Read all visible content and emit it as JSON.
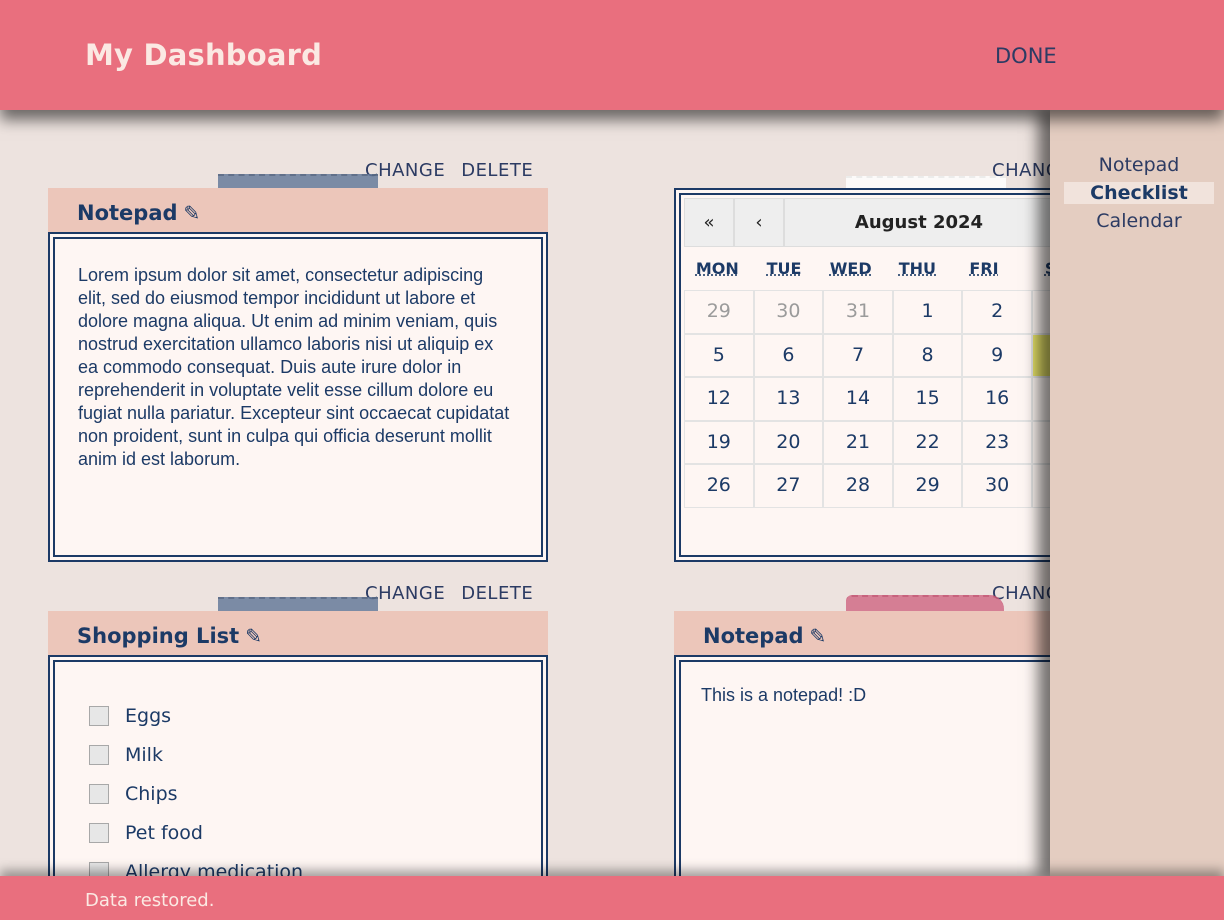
{
  "header": {
    "title": "My Dashboard",
    "done_label": "DONE"
  },
  "footer": {
    "status": "Data restored."
  },
  "actions": {
    "change": "CHANGE",
    "delete": "DELETE",
    "change_truncated": "CHANG"
  },
  "widgets": {
    "notepad1": {
      "title": "Notepad",
      "text": "Lorem ipsum dolor sit amet, consectetur adipiscing elit, sed do eiusmod tempor incididunt ut labore et dolore magna aliqua. Ut enim ad minim veniam, quis nostrud exercitation ullamco laboris nisi ut aliquip ex ea commodo consequat. Duis aute irure dolor in reprehenderit in voluptate velit esse cillum dolore eu fugiat nulla pariatur. Excepteur sint occaecat cupidatat non proident, sunt in culpa qui officia deserunt mollit anim id est laborum."
    },
    "calendar": {
      "first_label": "«",
      "prev_label": "‹",
      "month": "August 2024",
      "weekdays": [
        "MON",
        "TUE",
        "WED",
        "THU",
        "FRI",
        "S"
      ],
      "weeks": [
        [
          "29",
          "30",
          "31",
          "1",
          "2",
          ""
        ],
        [
          "5",
          "6",
          "7",
          "8",
          "9",
          ""
        ],
        [
          "12",
          "13",
          "14",
          "15",
          "16",
          ""
        ],
        [
          "19",
          "20",
          "21",
          "22",
          "23",
          ""
        ],
        [
          "26",
          "27",
          "28",
          "29",
          "30",
          ""
        ]
      ]
    },
    "shopping": {
      "title": "Shopping List",
      "items": [
        "Eggs",
        "Milk",
        "Chips",
        "Pet food",
        "Allergy medication"
      ]
    },
    "notepad2": {
      "title": "Notepad",
      "text": "This is a notepad! :D"
    }
  },
  "sidebar": {
    "items": [
      "Notepad",
      "Checklist",
      "Calendar"
    ],
    "active": "Checklist"
  },
  "colors": {
    "header": "#e96f7e",
    "background": "#ede3df",
    "sidebar": "#e4cdc1",
    "widget_title": "#ecc6ba",
    "text": "#1c3a66",
    "today": "#e8e46a"
  }
}
